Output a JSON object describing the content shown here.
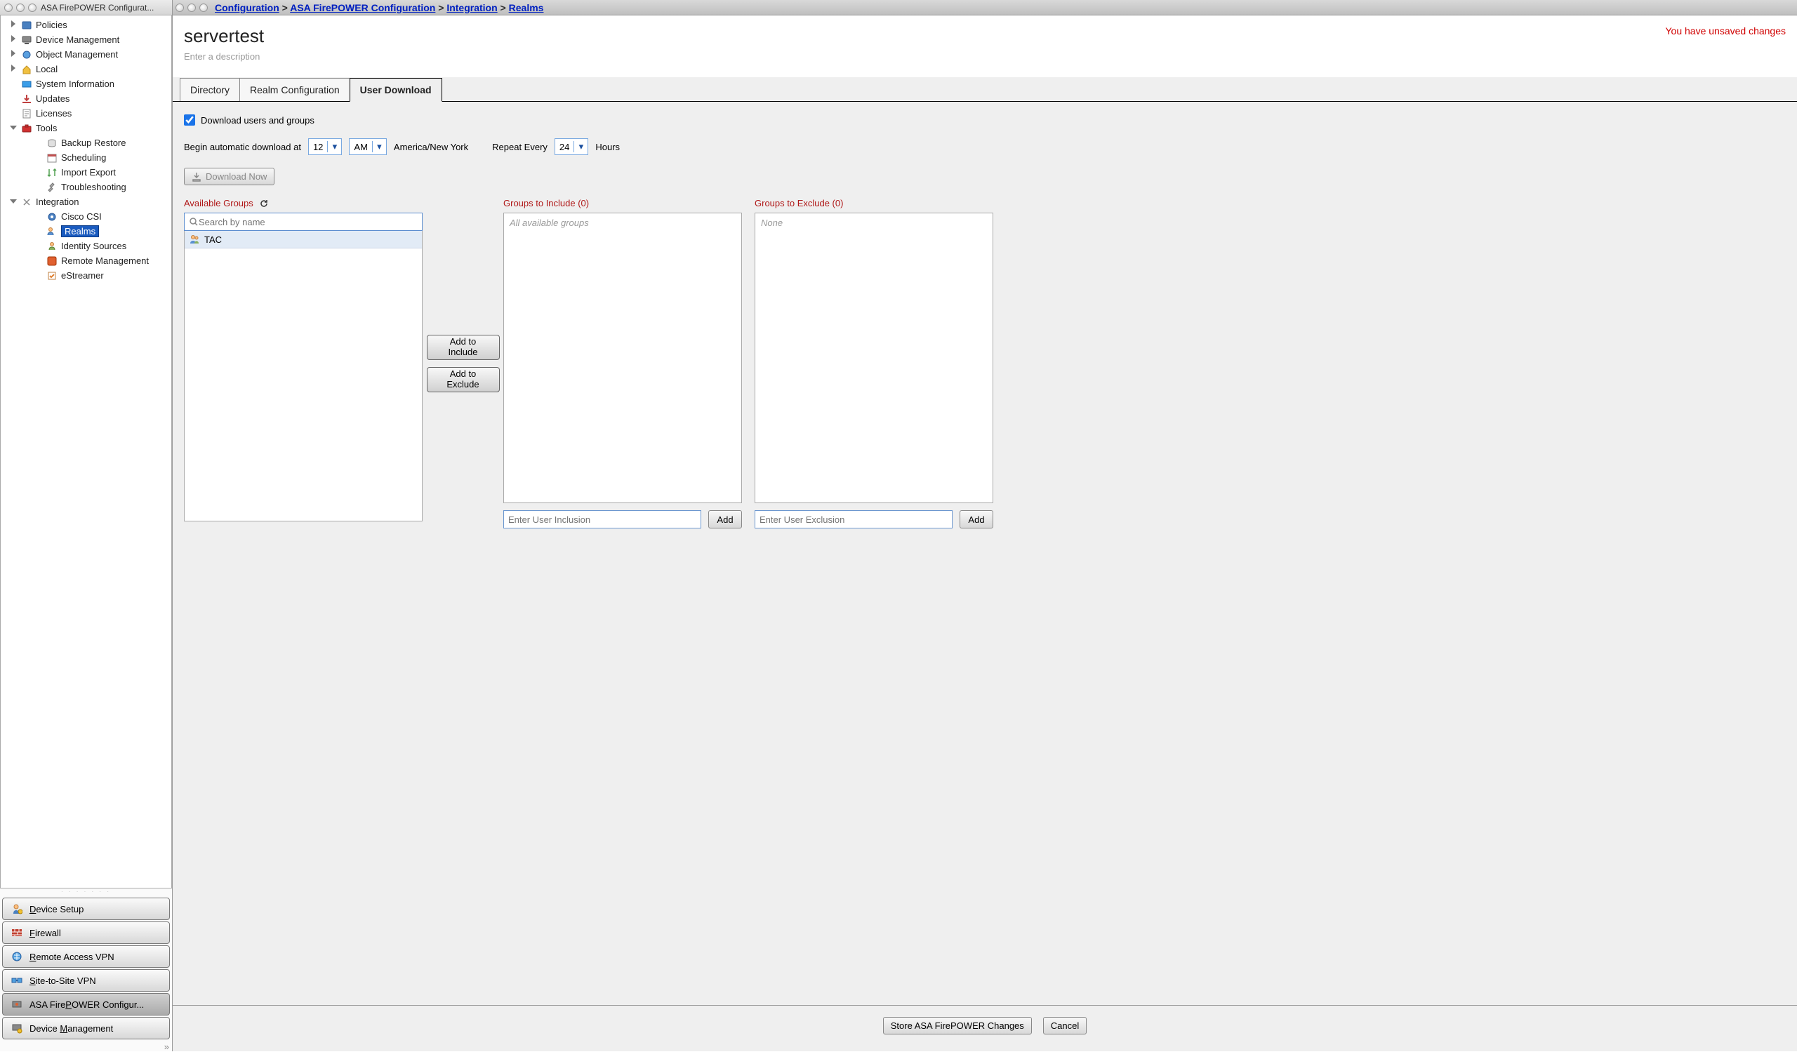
{
  "left": {
    "title": "ASA FirePOWER Configurat...",
    "tree": [
      {
        "label": "Policies",
        "depth": 0,
        "disc": "closed",
        "icon": "policies"
      },
      {
        "label": "Device Management",
        "depth": 0,
        "disc": "closed",
        "icon": "device"
      },
      {
        "label": "Object Management",
        "depth": 0,
        "disc": "closed",
        "icon": "object"
      },
      {
        "label": "Local",
        "depth": 0,
        "disc": "closed",
        "icon": "local"
      },
      {
        "label": "System Information",
        "depth": 0,
        "disc": "none",
        "icon": "sysinfo"
      },
      {
        "label": "Updates",
        "depth": 0,
        "disc": "none",
        "icon": "updates"
      },
      {
        "label": "Licenses",
        "depth": 0,
        "disc": "none",
        "icon": "licenses"
      },
      {
        "label": "Tools",
        "depth": 0,
        "disc": "open",
        "icon": "tools"
      },
      {
        "label": "Backup Restore",
        "depth": 1,
        "disc": "none",
        "icon": "backup"
      },
      {
        "label": "Scheduling",
        "depth": 1,
        "disc": "none",
        "icon": "sched"
      },
      {
        "label": "Import Export",
        "depth": 1,
        "disc": "none",
        "icon": "impexp"
      },
      {
        "label": "Troubleshooting",
        "depth": 1,
        "disc": "none",
        "icon": "trouble"
      },
      {
        "label": "Integration",
        "depth": 0,
        "disc": "open",
        "icon": "integration"
      },
      {
        "label": "Cisco CSI",
        "depth": 1,
        "disc": "none",
        "icon": "csi"
      },
      {
        "label": "Realms",
        "depth": 1,
        "disc": "none",
        "icon": "realms",
        "selected": true
      },
      {
        "label": "Identity Sources",
        "depth": 1,
        "disc": "none",
        "icon": "identity"
      },
      {
        "label": "Remote Management",
        "depth": 1,
        "disc": "none",
        "icon": "remotemgmt"
      },
      {
        "label": "eStreamer",
        "depth": 1,
        "disc": "none",
        "icon": "estreamer"
      }
    ],
    "bottom": [
      {
        "label": "Device Setup",
        "u": 0,
        "icon": "devsetup"
      },
      {
        "label": "Firewall",
        "u": 0,
        "icon": "firewall"
      },
      {
        "label": "Remote Access VPN",
        "u": 0,
        "icon": "ravpn"
      },
      {
        "label": "Site-to-Site VPN",
        "u": 0,
        "icon": "s2svpn"
      },
      {
        "label": "ASA FirePOWER Configur...",
        "u": 8,
        "icon": "asafp",
        "active": true
      },
      {
        "label": "Device Management",
        "u": 7,
        "icon": "devmgmt"
      }
    ]
  },
  "breadcrumb": {
    "items": [
      "Configuration",
      "ASA FirePOWER Configuration",
      "Integration",
      "Realms"
    ]
  },
  "header": {
    "title": "servertest",
    "desc_placeholder": "Enter a description",
    "unsaved": "You have unsaved changes"
  },
  "tabs": {
    "items": [
      "Directory",
      "Realm Configuration",
      "User Download"
    ],
    "active": 2
  },
  "download": {
    "checkbox_label": "Download users and groups",
    "checked": true,
    "begin_label": "Begin automatic download at",
    "hour": "12",
    "ampm": "AM",
    "timezone": "America/New York",
    "repeat_label": "Repeat Every",
    "repeat_value": "24",
    "repeat_unit": "Hours",
    "download_now": "Download Now"
  },
  "groups": {
    "available_title": "Available Groups",
    "search_placeholder": "Search by name",
    "available_items": [
      "TAC"
    ],
    "add_include": "Add to\nInclude",
    "add_exclude": "Add to\nExclude",
    "include_title": "Groups to Include (0)",
    "include_placeholder": "All available groups",
    "include_input_ph": "Enter User Inclusion",
    "include_add": "Add",
    "exclude_title": "Groups to Exclude (0)",
    "exclude_placeholder": "None",
    "exclude_input_ph": "Enter User Exclusion",
    "exclude_add": "Add"
  },
  "footer": {
    "save": "Store ASA FirePOWER Changes",
    "cancel": "Cancel"
  }
}
